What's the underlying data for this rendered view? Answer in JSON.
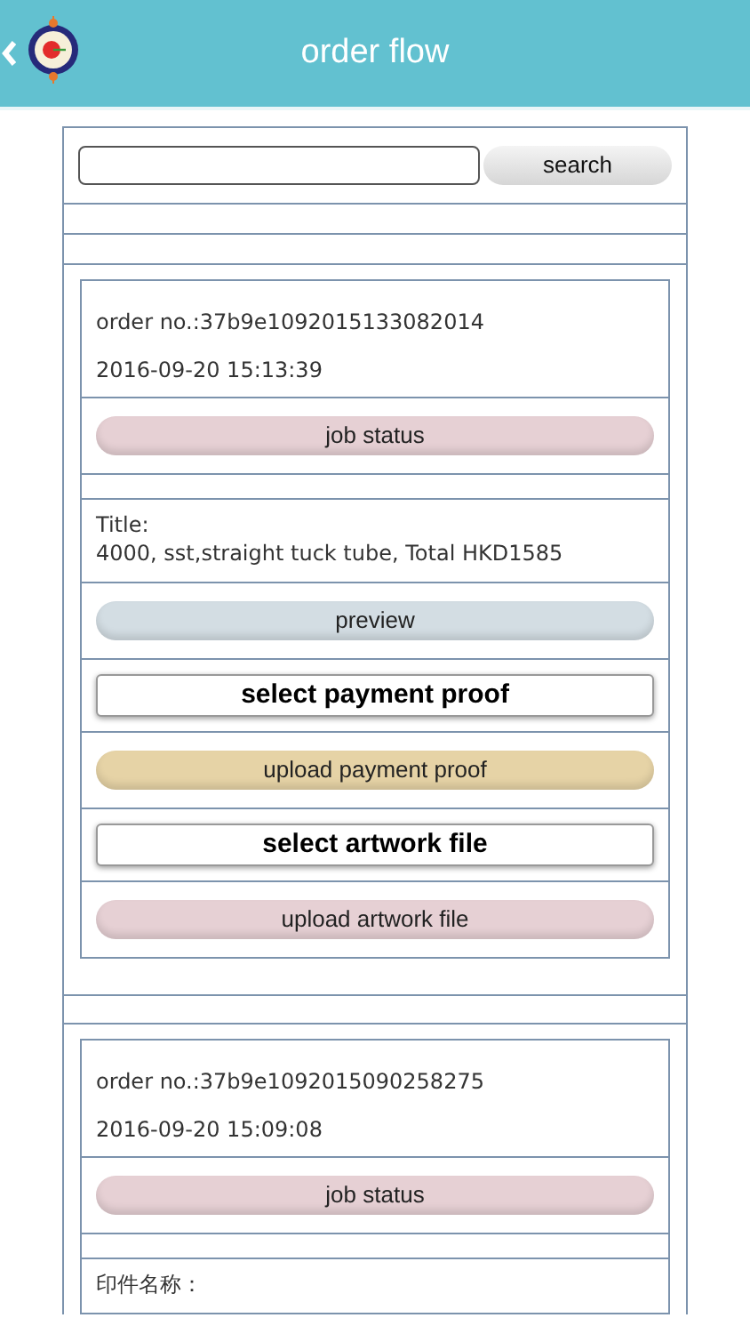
{
  "header": {
    "title": "order flow"
  },
  "search": {
    "button": "search"
  },
  "orders": [
    {
      "order_no": "order no.:37b9e1092015133082014",
      "date": "2016-09-20 15:13:39",
      "status_button": "job status",
      "title_label": "Title:",
      "title_text": "4000, sst,straight tuck tube, Total HKD1585",
      "actions": [
        {
          "kind": "pill",
          "label": "preview",
          "color": "#d3dde3"
        },
        {
          "kind": "file",
          "label": "select payment proof"
        },
        {
          "kind": "pill",
          "label": "upload payment proof",
          "color": "#e6d3a6"
        },
        {
          "kind": "file",
          "label": "select artwork file"
        },
        {
          "kind": "pill",
          "label": "upload artwork file",
          "color": "#e6d0d4"
        }
      ]
    },
    {
      "order_no": "order no.:37b9e1092015090258275",
      "date": "2016-09-20 15:09:08",
      "status_button": "job status",
      "title_label": "印件名称："
    }
  ]
}
